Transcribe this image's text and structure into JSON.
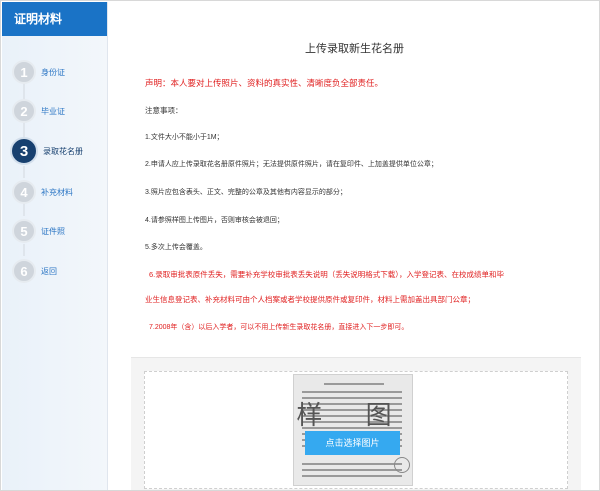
{
  "sidebar": {
    "header": "证明材料",
    "steps": [
      {
        "num": "1",
        "label": "身份证"
      },
      {
        "num": "2",
        "label": "毕业证"
      },
      {
        "num": "3",
        "label": "录取花名册"
      },
      {
        "num": "4",
        "label": "补充材料"
      },
      {
        "num": "5",
        "label": "证件照"
      },
      {
        "num": "6",
        "label": "返回"
      }
    ]
  },
  "main": {
    "title": "上传录取新生花名册",
    "declaration": "声明：本人要对上传照片、资料的真实性、清晰度负全部责任。",
    "notes_heading": "注意事项：",
    "notes": [
      "1.文件大小不能小于1M；",
      "2.申请人应上传录取花名册原件照片；无法提供原件照片，请在复印件、上加盖提供单位公章；",
      "3.照片应包含表头、正文、完整的公章及其他有内容显示的部分；",
      "4.请参照样图上传图片，否则审核会被退回；",
      "5.多次上传会覆盖。"
    ],
    "note6_part1": "6.录取审批表原件丢失，需要补充学校审批表丢失说明（",
    "note6_link": "丢失说明格式下载",
    "note6_part2": "），入学登记表、在校成绩单和毕",
    "note6_line2": "业生信息登记表、补充材料可由个人档案或者学校提供原件或复印件，材料上需加盖出具部门公章；",
    "note7": "7.2008年（含）以后入学者，可以不用上传新生录取花名册，直接进入下一步即可。"
  },
  "upload": {
    "watermark": "样 图",
    "button_label": "点击选择图片"
  }
}
